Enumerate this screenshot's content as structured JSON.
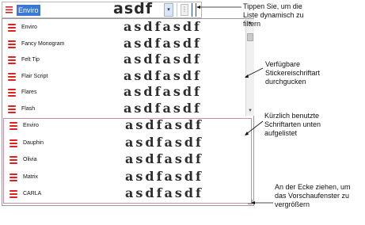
{
  "combo": {
    "value": "Enviro",
    "preview": "asdf",
    "dropdown_icon": "triangle-down",
    "extra_icon": "three-dots-vertical"
  },
  "font_list": {
    "items": [
      {
        "name": "Enviro",
        "preview": "asdfasdf"
      },
      {
        "name": "Fancy Monogram",
        "preview": "asdfasdf"
      },
      {
        "name": "Felt Tip",
        "preview": "asdfasdf"
      },
      {
        "name": "Flair Script",
        "preview": "asdfasdf"
      },
      {
        "name": "Flares",
        "preview": "asdfasdf"
      },
      {
        "name": "Flash",
        "preview": "asdfasdf"
      }
    ]
  },
  "recent_list": {
    "items": [
      {
        "name": "Enviro",
        "preview": "asdfasdf"
      },
      {
        "name": "Dauphin",
        "preview": "asdfasdf"
      },
      {
        "name": "Olivia",
        "preview": "asdfasdf"
      },
      {
        "name": "Matrix",
        "preview": "asdfasdf"
      },
      {
        "name": "CARLA",
        "preview": "asdfasdf"
      }
    ]
  },
  "annotations": {
    "filter": [
      "Tippen Sie, um die",
      "Liste dynamisch zu",
      "filtern"
    ],
    "browse": [
      "Verfügbare",
      "Stickereischriftart",
      "durchgucken"
    ],
    "recent": [
      "Kürzlich benutzte",
      "Schriftarten unten",
      "aufgelistet"
    ],
    "resize": [
      "An der Ecke ziehen, um",
      "das Vorschaufenster zu",
      "vergrößern"
    ]
  },
  "colors": {
    "selection": "#3d78d6",
    "font_icon": "#e0201f",
    "recent_border": "#c98db0"
  }
}
